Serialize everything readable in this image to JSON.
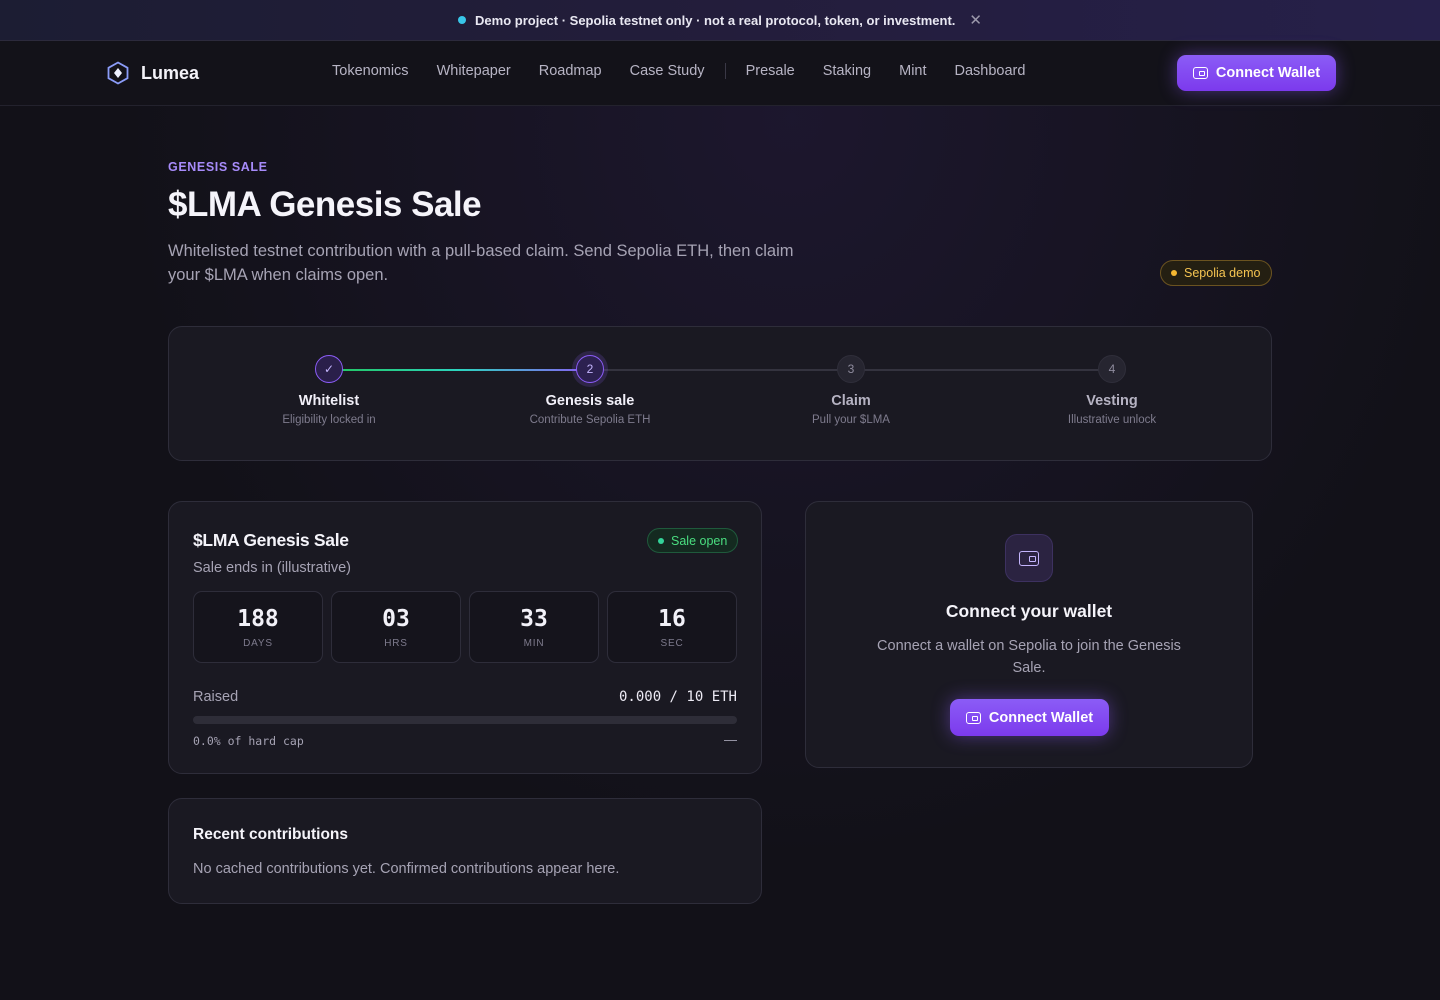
{
  "banner": {
    "text": "Demo project · Sepolia testnet only · not a real protocol, token, or investment.",
    "close": "✕"
  },
  "header": {
    "brand": "Lumea",
    "nav": [
      "Tokenomics",
      "Whitepaper",
      "Roadmap",
      "Case Study",
      "Presale",
      "Staking",
      "Mint",
      "Dashboard"
    ],
    "connect_label": "Connect Wallet"
  },
  "hero": {
    "eyebrow": "GENESIS SALE",
    "title": "$LMA Genesis Sale",
    "subtitle": "Whitelisted testnet contribution with a pull-based claim. Send Sepolia ETH, then claim your $LMA when claims open.",
    "network_badge": "Sepolia demo"
  },
  "stepper": {
    "steps": [
      {
        "marker": "✓",
        "title": "Whitelist",
        "sub": "Eligibility locked in",
        "state": "done"
      },
      {
        "marker": "2",
        "title": "Genesis sale",
        "sub": "Contribute Sepolia ETH",
        "state": "active"
      },
      {
        "marker": "3",
        "title": "Claim",
        "sub": "Pull your $LMA",
        "state": "todo"
      },
      {
        "marker": "4",
        "title": "Vesting",
        "sub": "Illustrative unlock",
        "state": "todo"
      }
    ]
  },
  "sale": {
    "title": "$LMA Genesis Sale",
    "status": "Sale open",
    "ends_label": "Sale ends in (illustrative)",
    "countdown": [
      {
        "value": "188",
        "unit": "DAYS"
      },
      {
        "value": "03",
        "unit": "HRS"
      },
      {
        "value": "33",
        "unit": "MIN"
      },
      {
        "value": "16",
        "unit": "SEC"
      }
    ],
    "raised_label": "Raised",
    "raised_value": "0.000 / 10 ETH",
    "progress_fraction": 0,
    "pct_text": "0.0% of hard cap",
    "pct_trailing": "—"
  },
  "recent": {
    "title": "Recent contributions",
    "empty": "No cached contributions yet. Confirmed contributions appear here."
  },
  "wallet": {
    "title": "Connect your wallet",
    "desc": "Connect a wallet on Sepolia to join the Genesis Sale.",
    "button": "Connect Wallet"
  },
  "colors": {
    "accent": "#8b5cf6",
    "success": "#34d399",
    "warning": "#f5b731",
    "background": "#121118"
  }
}
